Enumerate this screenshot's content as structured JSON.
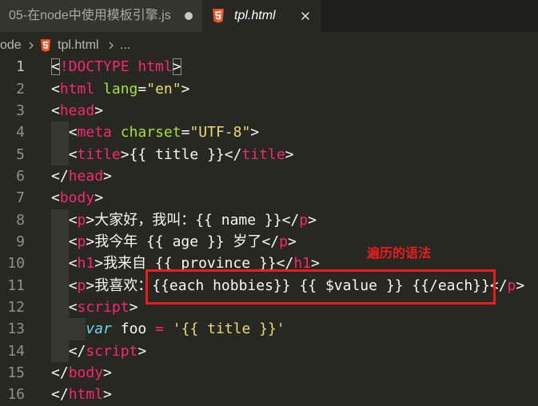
{
  "colors": {
    "editor_bg": "#272822",
    "tabbar_bg": "#1e1f1c",
    "tab_inactive_bg": "#34352f",
    "tab_inactive_fg": "#a8a8a3",
    "tab_active_fg": "#ffffff",
    "breadcrumb_fg": "#b9b9b4",
    "tag": "#f92672",
    "attr": "#a6e22e",
    "string": "#e6db74",
    "text": "#f8f8f2",
    "keyword": "#66d9ef",
    "operator": "#f92672",
    "line_number": "#90908a",
    "line_number_active": "#c2c2bf",
    "annotation": "#ea1c1c",
    "html_icon": "#e44f26"
  },
  "tabs": [
    {
      "label": "05-在node中使用模板引擎.js",
      "active": false,
      "status_icon": "modified-dot-icon"
    },
    {
      "label": "tpl.html",
      "active": true,
      "icon": "html5-icon",
      "close_icon": "close-icon"
    }
  ],
  "breadcrumb": {
    "folder": "ode",
    "separator_icon": "chevron-right-icon",
    "file_icon": "html5-icon",
    "file": "tpl.html",
    "symbol": "..."
  },
  "editor": {
    "active_line": 1,
    "lines": [
      {
        "n": 1,
        "tokens": [
          {
            "bracket_match": "<"
          },
          {
            "tag": "!DOCTYPE html"
          },
          {
            "bracket_match": ">"
          }
        ]
      },
      {
        "n": 2,
        "tokens": [
          {
            "punct": "<"
          },
          {
            "tag": "html"
          },
          {
            "text": " "
          },
          {
            "attr": "lang"
          },
          {
            "punct": "="
          },
          {
            "string": "\"en\""
          },
          {
            "punct": ">"
          }
        ]
      },
      {
        "n": 3,
        "tokens": [
          {
            "punct": "<"
          },
          {
            "tag": "head"
          },
          {
            "punct": ">"
          }
        ]
      },
      {
        "n": 4,
        "tokens": [
          {
            "indent": "  "
          },
          {
            "punct": "<"
          },
          {
            "tag": "meta"
          },
          {
            "text": " "
          },
          {
            "attr": "charset"
          },
          {
            "punct": "="
          },
          {
            "string": "\"UTF-8\""
          },
          {
            "punct": ">"
          }
        ]
      },
      {
        "n": 5,
        "tokens": [
          {
            "indent": "  "
          },
          {
            "punct": "<"
          },
          {
            "tag": "title"
          },
          {
            "punct": ">"
          },
          {
            "text": "{{ title }}"
          },
          {
            "punct": "</"
          },
          {
            "tag": "title"
          },
          {
            "punct": ">"
          }
        ]
      },
      {
        "n": 6,
        "tokens": [
          {
            "punct": "</"
          },
          {
            "tag": "head"
          },
          {
            "punct": ">"
          }
        ]
      },
      {
        "n": 7,
        "tokens": [
          {
            "punct": "<"
          },
          {
            "tag": "body"
          },
          {
            "punct": ">"
          }
        ]
      },
      {
        "n": 8,
        "tokens": [
          {
            "indent": "  "
          },
          {
            "punct": "<"
          },
          {
            "tag": "p"
          },
          {
            "punct": ">"
          },
          {
            "text": "大家好，我叫：{{ name }}"
          },
          {
            "punct": "</"
          },
          {
            "tag": "p"
          },
          {
            "punct": ">"
          }
        ]
      },
      {
        "n": 9,
        "tokens": [
          {
            "indent": "  "
          },
          {
            "punct": "<"
          },
          {
            "tag": "p"
          },
          {
            "punct": ">"
          },
          {
            "text": "我今年 {{ age }} 岁了"
          },
          {
            "punct": "</"
          },
          {
            "tag": "p"
          },
          {
            "punct": ">"
          }
        ]
      },
      {
        "n": 10,
        "tokens": [
          {
            "indent": "  "
          },
          {
            "punct": "<"
          },
          {
            "tag": "h1"
          },
          {
            "punct": ">"
          },
          {
            "text": "我来自 {{ province }}"
          },
          {
            "punct": "</"
          },
          {
            "tag": "h1"
          },
          {
            "punct": ">"
          }
        ]
      },
      {
        "n": 11,
        "tokens": [
          {
            "indent": "  "
          },
          {
            "punct": "<"
          },
          {
            "tag": "p"
          },
          {
            "punct": ">"
          },
          {
            "text": "我喜欢："
          },
          {
            "text": "{{each hobbies}} {{ $value }} {{/each}}",
            "boxed": true
          },
          {
            "punct": "</"
          },
          {
            "tag": "p"
          },
          {
            "punct": ">"
          }
        ]
      },
      {
        "n": 12,
        "tokens": [
          {
            "indent": "  "
          },
          {
            "punct": "<"
          },
          {
            "tag": "script"
          },
          {
            "punct": ">"
          }
        ]
      },
      {
        "n": 13,
        "tokens": [
          {
            "indent": "  "
          },
          {
            "indent": "  "
          },
          {
            "keyword": "var"
          },
          {
            "text": " foo "
          },
          {
            "operator": "="
          },
          {
            "text": " "
          },
          {
            "string": "'{{ title }}'"
          }
        ]
      },
      {
        "n": 14,
        "tokens": [
          {
            "indent": "  "
          },
          {
            "punct": "</"
          },
          {
            "tag": "script"
          },
          {
            "punct": ">"
          }
        ]
      },
      {
        "n": 15,
        "tokens": [
          {
            "punct": "</"
          },
          {
            "tag": "body"
          },
          {
            "punct": ">"
          }
        ]
      },
      {
        "n": 16,
        "tokens": [
          {
            "punct": "</"
          },
          {
            "tag": "html"
          },
          {
            "punct": ">"
          }
        ]
      }
    ]
  },
  "annotation": {
    "label": "遍历的语法"
  }
}
